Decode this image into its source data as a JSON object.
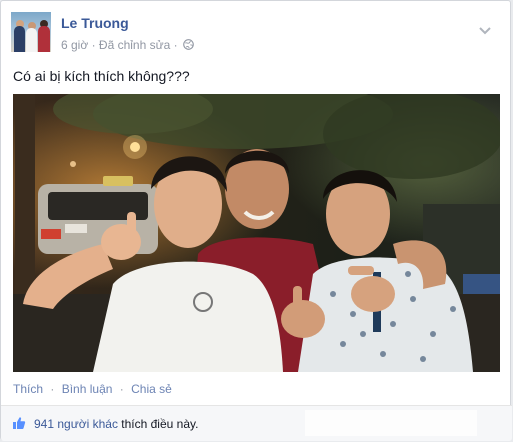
{
  "post": {
    "author_name": "Le Truong",
    "time": "6 giờ",
    "edited_label": "Đã chỉnh sửa",
    "meta_separator": "·",
    "privacy_icon": "globe-icon",
    "menu_icon": "chevron-down-icon",
    "status_text": "Có ai bị kích thích không???"
  },
  "actions": {
    "like_label": "Thích",
    "comment_label": "Bình luận",
    "share_label": "Chia sẻ",
    "separator": "·"
  },
  "likes": {
    "icon": "thumbs-up-icon",
    "count_text": "941 người khác",
    "suffix_text": " thích điều này."
  },
  "colors": {
    "link_blue": "#3b5998",
    "action_blue": "#6d84b4",
    "meta_gray": "#9197a3",
    "like_bar_bg": "#f6f7f9"
  }
}
